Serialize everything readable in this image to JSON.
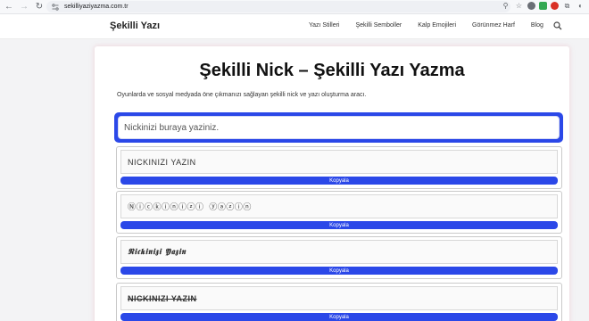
{
  "browser": {
    "url": "sekilliyaziyazma.com.tr"
  },
  "header": {
    "logo": "Şekilli Yazı",
    "menu": [
      "Yazı Stilleri",
      "Şekilli Semboller",
      "Kalp Emojileri",
      "Görünmez Harf",
      "Blog"
    ]
  },
  "main": {
    "title": "Şekilli Nick – Şekilli Yazı Yazma",
    "description": "Oyunlarda ve sosyal medyada öne çıkmanızı sağlayan şekilli nick ve yazı oluşturma aracı.",
    "input_placeholder": "Nickinizi buraya yaziniz.",
    "copy_label": "Kopyala",
    "results": [
      "NICKINIZI YAZIN",
      "Ⓝⓘⓒⓚⓘⓝⓘⓩⓘ ⓨⓐⓩⓘⓝ",
      "𝕹𝖎𝖈𝖐𝖎𝖓𝖎𝖟𝖎 𝖄𝖆𝖟𝖎𝖓",
      "NICKINIZI YAZIN"
    ]
  }
}
